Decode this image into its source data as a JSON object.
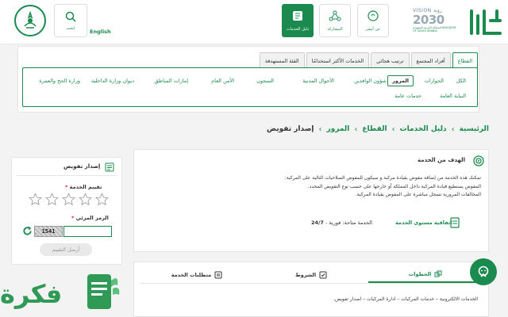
{
  "header": {
    "search_label": "ابحث",
    "language_link": "English",
    "nav_tiles": [
      {
        "label": "دليل الخدمات",
        "icon": "book-icon",
        "active": true
      },
      {
        "label": "المشاركة",
        "icon": "participation-icon"
      },
      {
        "label": "عن أبشر",
        "icon": "about-icon"
      }
    ],
    "vision": {
      "line1": "VISION رؤية",
      "line2": "2030",
      "line3": "المملكة العربية السعودية KINGDOM OF SAUDI ARABIA"
    }
  },
  "filter_tabs": [
    "القطاع",
    "أفراد المجتمع",
    "ترتيب هجائي",
    "الخدمات الأكثر استخدامًا",
    "الفئة المستهدفة"
  ],
  "sector_chips": [
    "الكل",
    "الجوازات",
    "المرور",
    "شؤون الوافدين",
    "الأحوال المدنية",
    "السجون",
    "الأمن العام",
    "إمارات المناطق",
    "ديوان وزارة الداخلية",
    "وزارة الحج والعمرة",
    "النيابة العامة",
    "خدمات عامة"
  ],
  "breadcrumb": {
    "home": "الرئيسية",
    "services_guide": "دليل الخدمات",
    "sector": "القطاع",
    "traffic": "المرور",
    "current": "إصدار تفويض"
  },
  "service": {
    "goal_title": "الهدف من الخدمة",
    "description": [
      "تمكنك هذه الخدمة من إضافة مفوض بقيادة مركبة و سيكون للمفوض الصلاحيات التالية على المركبة:",
      "المفوض يستطيع قيادة المركبة داخل المملكة أو خارجها على حسب نوع التفويض المحدد.",
      "المخالفات المرورية تسجل مباشرة على المفوض بقيادة المركبة."
    ],
    "sla_label": "اتفاقية مستوى الخدمة",
    "availability_label": "الخدمة متاحة: فورية -",
    "availability_value": "24/7"
  },
  "rating": {
    "title": "إصدار تفويض",
    "rating_label": "تقييم الخدمة",
    "stars_total": 5,
    "stars_selected": 0,
    "captcha_label": "الرمز المرئي",
    "captcha_code": "1541",
    "captcha_value": "",
    "submit_label": "أرسل التقييم",
    "required_mark": "*"
  },
  "bottom_tabs": [
    {
      "label": "الخطوات",
      "icon": "steps-icon",
      "active": true
    },
    {
      "label": "الشروط",
      "icon": "conditions-icon"
    },
    {
      "label": "متطلبات الخدمة",
      "icon": "requirements-icon"
    }
  ],
  "steps_text": "الخدمات الالكترونية – خدمات المركبات – ادارة المركبات – اصدار تفويض.",
  "watermark": {
    "text": "فكرة"
  },
  "colors": {
    "brand": "#1b8a4e",
    "background": "#f3f3f3"
  }
}
